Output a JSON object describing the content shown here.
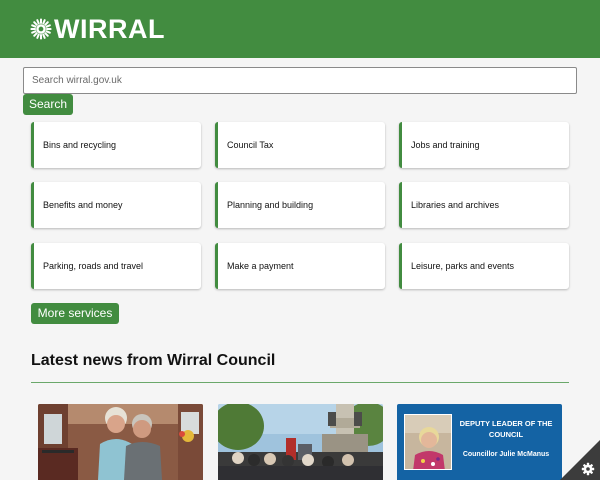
{
  "header": {
    "logo_text": "WIRRAL",
    "brand_color": "#428c40"
  },
  "search": {
    "placeholder": "Search wirral.gov.uk",
    "button_label": "Search"
  },
  "services": [
    {
      "label": "Bins and recycling"
    },
    {
      "label": "Council Tax"
    },
    {
      "label": "Jobs and training"
    },
    {
      "label": "Benefits and money"
    },
    {
      "label": "Planning and building"
    },
    {
      "label": "Libraries and archives"
    },
    {
      "label": "Parking, roads and travel"
    },
    {
      "label": "Make a payment"
    },
    {
      "label": "Leisure, parks and events"
    }
  ],
  "more_services_label": "More services",
  "news": {
    "heading": "Latest news from Wirral Council",
    "deputy_leader_card": {
      "title": "DEPUTY LEADER OF THE COUNCIL",
      "name": "Councillor Julie McManus",
      "background": "#1463a4"
    }
  },
  "icons": {
    "logo": "wirral-burst-icon",
    "settings": "gear-icon"
  }
}
